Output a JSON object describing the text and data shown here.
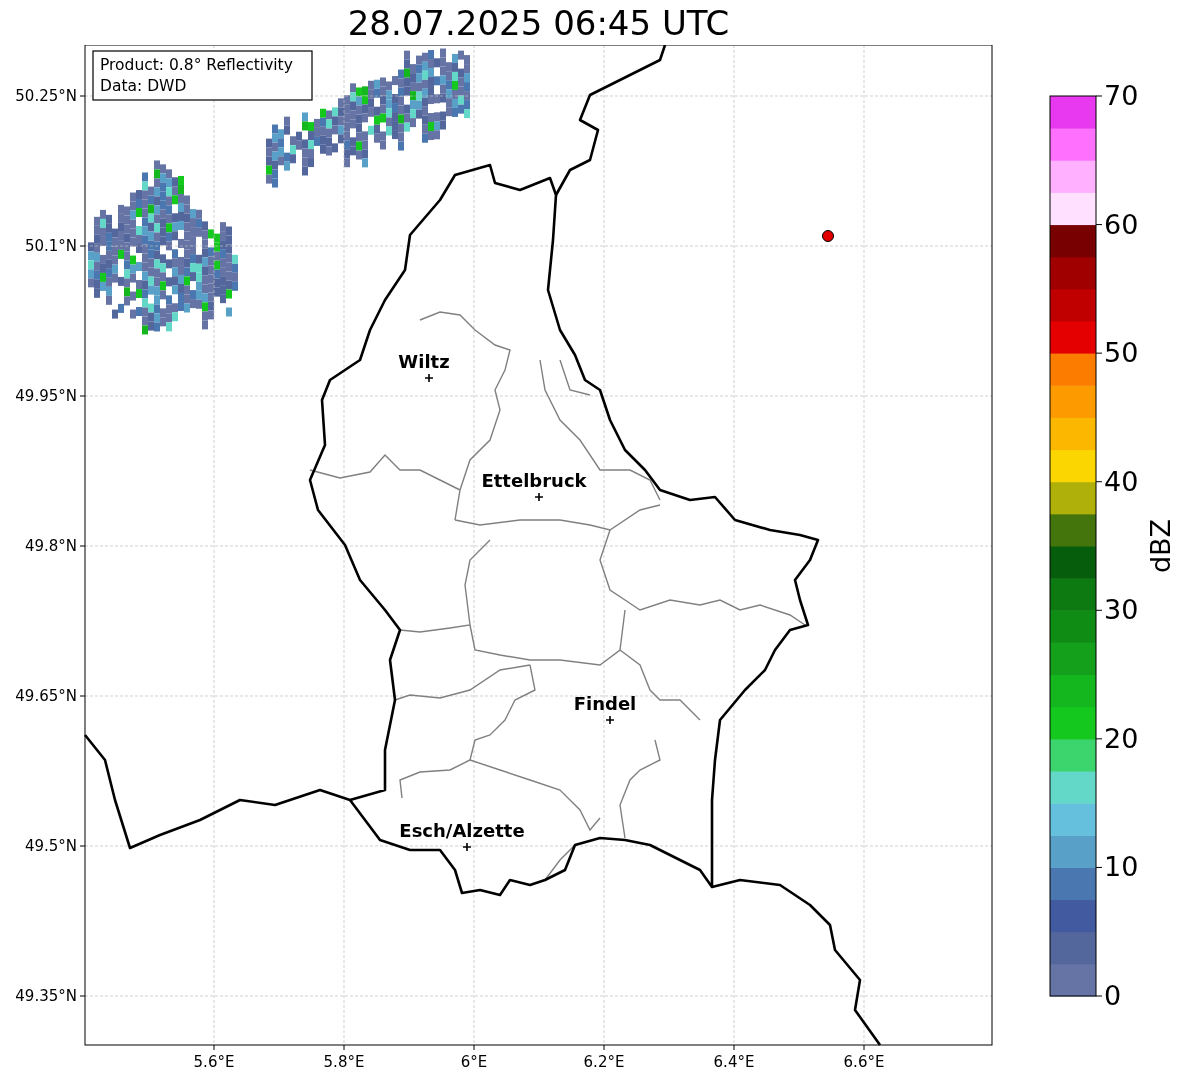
{
  "title": "28.07.2025 06:45 UTC",
  "info_box": {
    "lines": [
      "Product: 0.8° Reflectivity",
      "Data: DWD"
    ]
  },
  "map": {
    "cities": [
      {
        "name": "Wiltz"
      },
      {
        "name": "Ettelbruck"
      },
      {
        "name": "Findel"
      },
      {
        "name": "Esch/Alzette"
      }
    ],
    "lat_labels": [
      "50.25°N",
      "50.1°N",
      "49.95°N",
      "49.8°N",
      "49.65°N",
      "49.5°N",
      "49.35°N"
    ],
    "lon_labels": [
      "5.6°E",
      "5.8°E",
      "6°E",
      "6.2°E",
      "6.4°E",
      "6.6°E"
    ]
  },
  "colorbar": {
    "label": "dBZ",
    "ticks": [
      "70",
      "60",
      "50",
      "40",
      "30",
      "20",
      "10",
      "0"
    ],
    "bins": [
      {
        "color": "#6674a5"
      },
      {
        "color": "#54679d"
      },
      {
        "color": "#425ba0"
      },
      {
        "color": "#4a77b0"
      },
      {
        "color": "#58a0c8"
      },
      {
        "color": "#64c0dc"
      },
      {
        "color": "#64d8c8"
      },
      {
        "color": "#3cd46c"
      },
      {
        "color": "#14c81e"
      },
      {
        "color": "#14b81e"
      },
      {
        "color": "#14a01a"
      },
      {
        "color": "#0e8c14"
      },
      {
        "color": "#0c7a10"
      },
      {
        "color": "#065e0c"
      },
      {
        "color": "#44740c"
      },
      {
        "color": "#b0b00a"
      },
      {
        "color": "#fcd600"
      },
      {
        "color": "#fcb800"
      },
      {
        "color": "#fc9a00"
      },
      {
        "color": "#fc7c00"
      },
      {
        "color": "#e40000"
      },
      {
        "color": "#c00000"
      },
      {
        "color": "#a00000"
      },
      {
        "color": "#780000"
      },
      {
        "color": "#ffe0ff"
      },
      {
        "color": "#ffb0ff"
      },
      {
        "color": "#ff70ff"
      },
      {
        "color": "#e838f0"
      }
    ]
  }
}
